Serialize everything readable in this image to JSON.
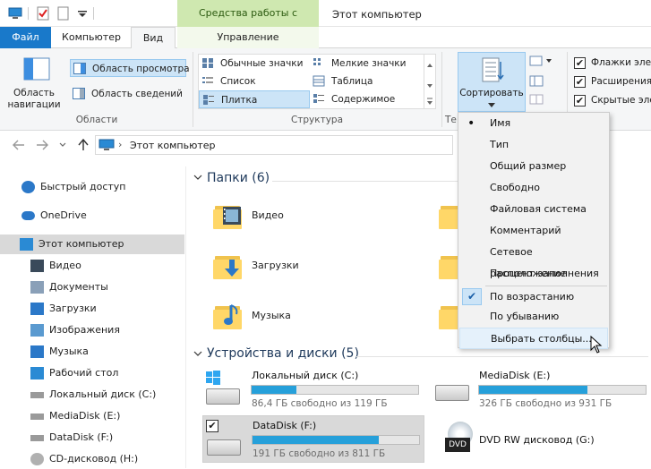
{
  "titlebar": {
    "contextual_tab": "Средства работы с дисками",
    "window_title": "Этот компьютер"
  },
  "tabs": {
    "file": "Файл",
    "computer": "Компьютер",
    "view": "Вид",
    "manage": "Управление"
  },
  "ribbon": {
    "nav_pane": "Область навигации",
    "preview_pane": "Область просмотра",
    "details_pane": "Область сведений",
    "group_areas": "Области",
    "layout": {
      "normal_icons": "Обычные значки",
      "small_icons": "Мелкие значки",
      "list": "Список",
      "table": "Таблица",
      "tiles": "Плитка",
      "content": "Содержимое"
    },
    "group_structure": "Структура",
    "group_current_truncated": "Те",
    "sort_button": "Сортировать",
    "checkboxes": {
      "item_flags": "Флажки элем",
      "extensions": "Расширения",
      "hidden": "Скрытые эле"
    }
  },
  "address": {
    "path": "Этот компьютер",
    "sep": "›"
  },
  "nav": [
    {
      "label": "Быстрый доступ",
      "icon": "star-icon"
    },
    {
      "label": "OneDrive",
      "icon": "cloud-icon"
    },
    {
      "label": "Этот компьютер",
      "icon": "computer-icon"
    },
    {
      "label": "Видео",
      "icon": "video-icon"
    },
    {
      "label": "Документы",
      "icon": "documents-icon"
    },
    {
      "label": "Загрузки",
      "icon": "downloads-icon"
    },
    {
      "label": "Изображения",
      "icon": "pictures-icon"
    },
    {
      "label": "Музыка",
      "icon": "music-icon"
    },
    {
      "label": "Рабочий стол",
      "icon": "desktop-icon"
    },
    {
      "label": "Локальный диск (C:)",
      "icon": "drive-icon"
    },
    {
      "label": "MediaDisk (E:)",
      "icon": "drive-icon"
    },
    {
      "label": "DataDisk (F:)",
      "icon": "drive-icon"
    },
    {
      "label": "CD-дисковод (H:)",
      "icon": "cd-icon"
    }
  ],
  "folders_section": {
    "title": "Папки (6)",
    "items": [
      "Видео",
      "Загрузки",
      "Музыка"
    ]
  },
  "devices_section": {
    "title": "Устройства и диски (5)",
    "drives": [
      {
        "name": "Локальный диск (C:)",
        "free": "86,4 ГБ свободно из 119 ГБ",
        "used_fraction": 0.27
      },
      {
        "name": "MediaDisk (E:)",
        "free": "326 ГБ свободно из 931 ГБ",
        "used_fraction": 0.65
      },
      {
        "name": "DataDisk (F:)",
        "free": "191 ГБ свободно из 811 ГБ",
        "used_fraction": 0.76
      },
      {
        "name": "DVD RW дисковод (G:)",
        "dvd_label": "DVD"
      }
    ]
  },
  "sort_menu": {
    "items": [
      "Имя",
      "Тип",
      "Общий размер",
      "Свободно",
      "Файловая система",
      "Комментарий",
      "Сетевое расположение",
      "Процент заполнения"
    ],
    "order": [
      "По возрастанию",
      "По убыванию"
    ],
    "choose_columns": "Выбрать столбцы...",
    "bullet": "•",
    "check": "✔"
  },
  "colors": {
    "accent": "#1979ca",
    "contextual": "#cfe8b0",
    "progress": "#26a0da",
    "selection": "#cce4f7"
  }
}
